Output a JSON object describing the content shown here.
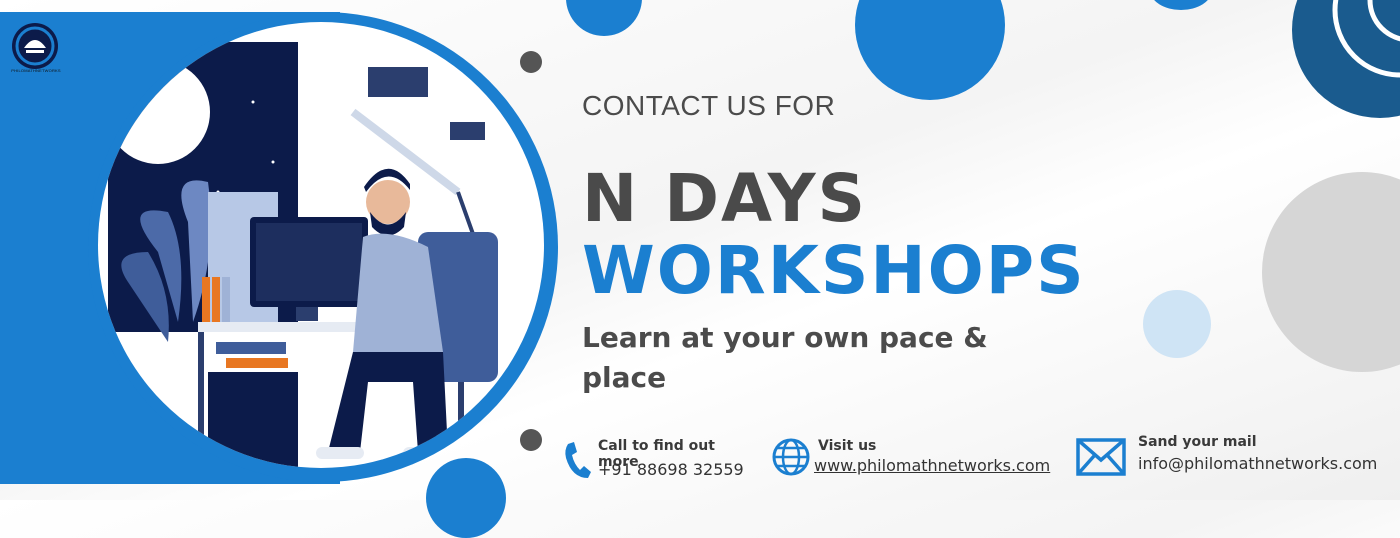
{
  "brand": {
    "logo_text": "PHILOMATHNETWORKS"
  },
  "hero": {
    "subtitle": "CONTACT US FOR",
    "headline_line1": "N DAYS",
    "headline_line2": "WORKSHOPS",
    "tagline": "Learn at your own pace & place"
  },
  "contacts": {
    "phone": {
      "title": "Call to find out more",
      "value": "+91 88698 32559",
      "icon": "phone-icon"
    },
    "web": {
      "title": "Visit us",
      "value": "www.philomathnetworks.com",
      "icon": "globe-icon"
    },
    "mail": {
      "title": "Sand your mail",
      "value": "info@philomathnetworks.com",
      "icon": "mail-icon"
    }
  },
  "colors": {
    "brand_blue": "#1b7fd0",
    "dark_gray": "#4a4a4a",
    "navy": "#0c1b4a"
  }
}
